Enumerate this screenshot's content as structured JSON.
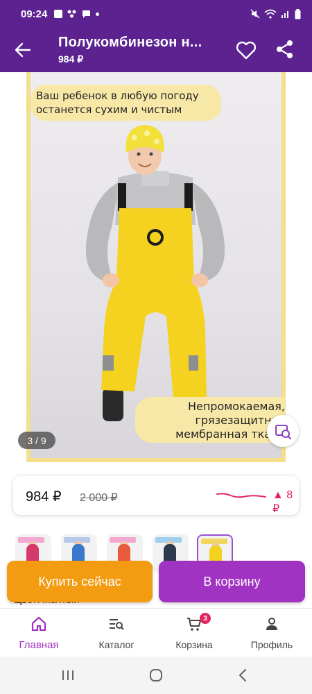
{
  "status_bar": {
    "time": "09:24"
  },
  "header": {
    "title": "Полукомбинезон н...",
    "price": "984 ₽"
  },
  "gallery": {
    "caption_top_line1": "Ваш ребенок в любую погоду",
    "caption_top_line2": "останется сухим и чистым",
    "caption_bottom_line1": "Непромокаемая,",
    "caption_bottom_line2": "грязезащитная",
    "caption_bottom_line3": "мембранная ткань",
    "counter": "3 / 9"
  },
  "price_card": {
    "current": "984 ₽",
    "old": "2 000 ₽",
    "change": "▲ 8 ₽"
  },
  "color_line": "Цвет: желтый",
  "actions": {
    "buy_now": "Купить сейчас",
    "add_to_cart": "В корзину"
  },
  "bottom_nav": {
    "items": [
      {
        "label": "Главная",
        "icon": "home-icon",
        "active": true
      },
      {
        "label": "Каталог",
        "icon": "catalog-search-icon",
        "active": false
      },
      {
        "label": "Корзина",
        "icon": "cart-icon",
        "active": false,
        "badge": "3"
      },
      {
        "label": "Профиль",
        "icon": "profile-icon",
        "active": false
      }
    ]
  },
  "colors": {
    "brand_purple": "#5b2290",
    "cart_button": "#a033c2",
    "buy_button": "#f39c12",
    "price_drop": "#e0245e"
  }
}
